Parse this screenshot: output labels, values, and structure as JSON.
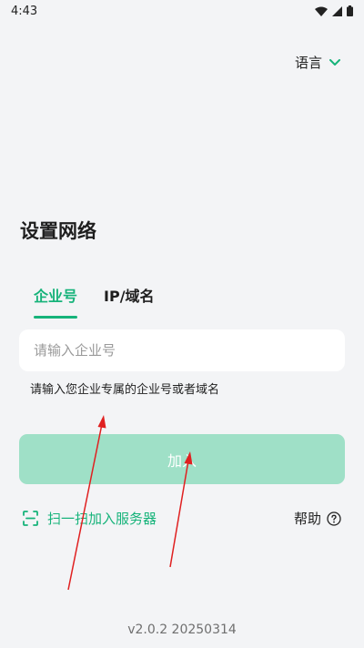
{
  "status_bar": {
    "time": "4:43"
  },
  "language": {
    "label": "语言"
  },
  "title": "设置网络",
  "tabs": [
    {
      "label": "企业号",
      "active": true
    },
    {
      "label": "IP/域名",
      "active": false
    }
  ],
  "input": {
    "placeholder": "请输入企业号",
    "value": ""
  },
  "hint": "请输入您企业专属的企业号或者域名",
  "join_button": {
    "label": "加入"
  },
  "scan": {
    "label": "扫一扫加入服务器"
  },
  "help": {
    "label": "帮助"
  },
  "version": "v2.0.2 20250314",
  "colors": {
    "accent": "#16b37a",
    "button_disabled": "#9fe0c7",
    "background": "#f3f4f6",
    "annotation": "#e02020"
  }
}
